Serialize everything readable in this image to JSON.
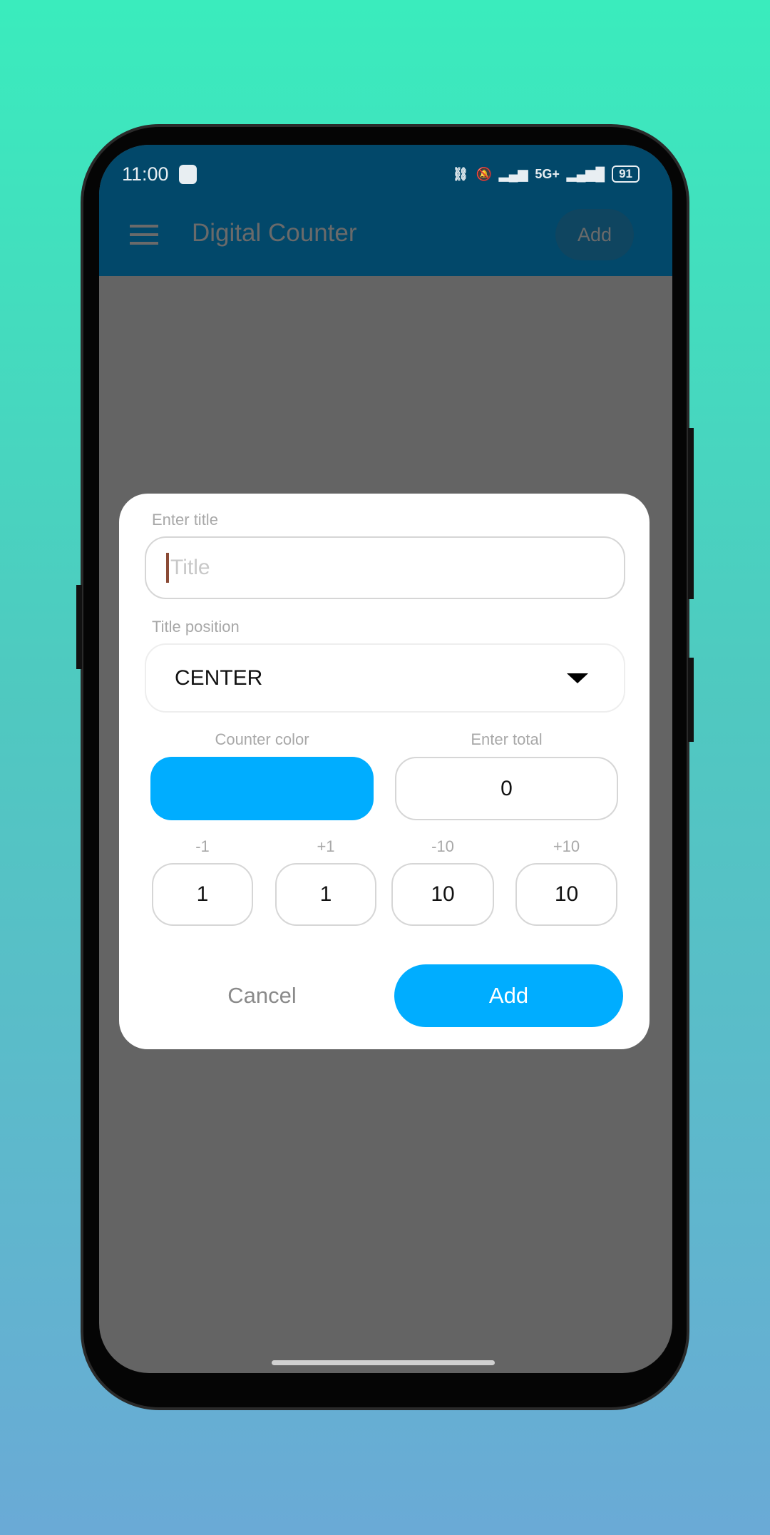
{
  "status_bar": {
    "time": "11:00",
    "battery": "91",
    "network": "5G+"
  },
  "app_bar": {
    "title": "Digital Counter",
    "add_label": "Add"
  },
  "dialog": {
    "title_label": "Enter title",
    "title_value": "",
    "title_placeholder": "Title",
    "position_label": "Title position",
    "position_value": "CENTER",
    "color_label": "Counter color",
    "counter_color": "#00adff",
    "total_label": "Enter total",
    "total_value": "0",
    "steps": [
      {
        "label": "-1",
        "value": "1"
      },
      {
        "label": "+1",
        "value": "1"
      },
      {
        "label": "-10",
        "value": "10"
      },
      {
        "label": "+10",
        "value": "10"
      }
    ],
    "cancel_label": "Cancel",
    "add_label": "Add"
  }
}
